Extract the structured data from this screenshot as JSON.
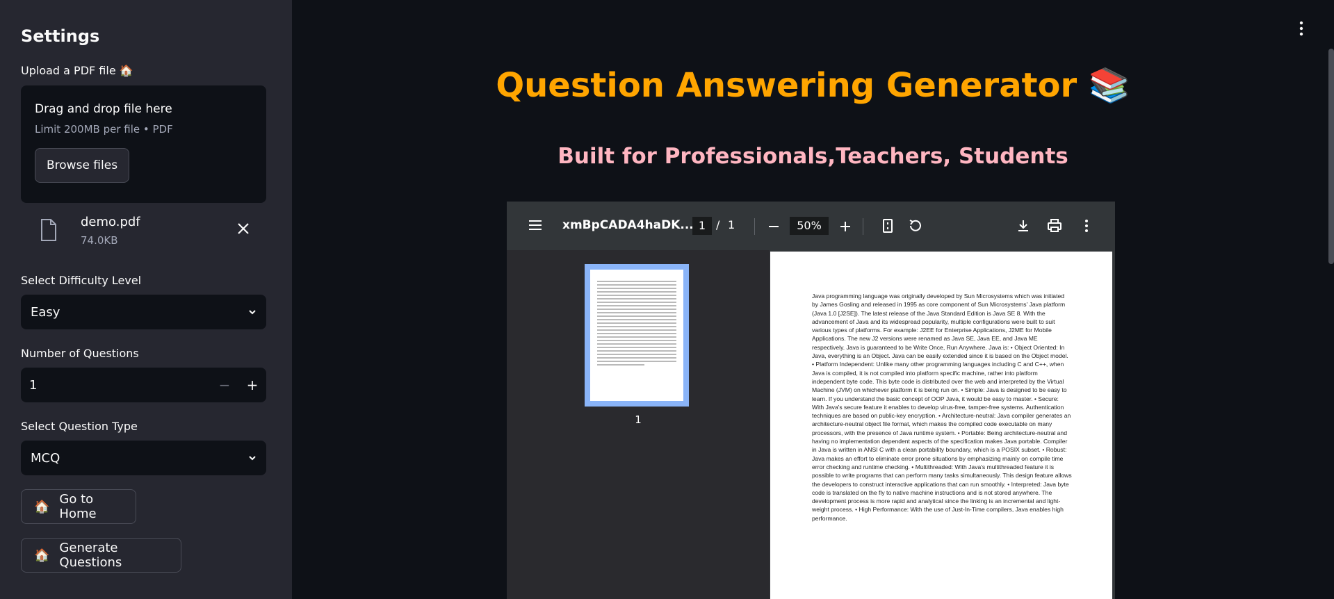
{
  "sidebar": {
    "title": "Settings",
    "upload_label": "Upload a PDF file 🏠",
    "dropzone": {
      "title": "Drag and drop file here",
      "subtitle": "Limit 200MB per file • PDF",
      "browse_label": "Browse files"
    },
    "file": {
      "name": "demo.pdf",
      "size": "74.0KB"
    },
    "difficulty": {
      "label": "Select Difficulty Level",
      "value": "Easy"
    },
    "num_questions": {
      "label": "Number of Questions",
      "value": "1",
      "minus": "−",
      "plus": "+"
    },
    "question_type": {
      "label": "Select Question Type",
      "value": "MCQ"
    },
    "home_button": {
      "icon": "🏠",
      "label": "Go to Home"
    },
    "generate_button": {
      "icon": "🏠",
      "label": "Generate Questions"
    }
  },
  "main": {
    "title": "Question Answering Generator 📚",
    "subtitle": "Built for Professionals,Teachers, Students"
  },
  "pdf_viewer": {
    "filename": "xmBpCADA4haDK...",
    "page_current": "1",
    "page_separator": "/",
    "page_total": "1",
    "zoom": "50%",
    "thumb_label": "1",
    "page_text": "Java programming language was originally developed by Sun Microsystems which was initiated by James Gosling and released in 1995 as core component of Sun Microsystems' Java platform (Java 1.0 [J2SE]). The latest release of the Java Standard Edition is Java SE 8. With the advancement of Java and its widespread popularity, multiple configurations were built to suit various types of platforms. For example: J2EE for Enterprise Applications, J2ME for Mobile Applications. The new J2 versions were renamed as Java SE, Java EE, and Java ME respectively. Java is guaranteed to be Write Once, Run Anywhere. Java is: • Object Oriented: In Java, everything is an Object. Java can be easily extended since it is based on the Object model. • Platform Independent: Unlike many other programming languages including C and C++, when Java is compiled, it is not compiled into platform specific machine, rather into platform independent byte code. This byte code is distributed over the web and interpreted by the Virtual Machine (JVM) on whichever platform it is being run on. • Simple: Java is designed to be easy to learn. If you understand the basic concept of OOP Java, it would be easy to master. • Secure: With Java's secure feature it enables to develop virus-free, tamper-free systems. Authentication techniques are based on public-key encryption. • Architecture-neutral: Java compiler generates an architecture-neutral object file format, which makes the compiled code executable on many processors, with the presence of Java runtime system. • Portable: Being architecture-neutral and having no implementation dependent aspects of the specification makes Java portable. Compiler in Java is written in ANSI C with a clean portability boundary, which is a POSIX subset. • Robust: Java makes an effort to eliminate error prone situations by emphasizing mainly on compile time error checking and runtime checking. • Multithreaded: With Java's multithreaded feature it is possible to write programs that can perform many tasks simultaneously. This design feature allows the developers to construct interactive applications that can run smoothly. • Interpreted: Java byte code is translated on the fly to native machine instructions and is not stored anywhere. The development process is more rapid and analytical since the linking is an incremental and light-weight process. • High Performance: With the use of Just-In-Time compilers, Java enables high performance."
  },
  "colors": {
    "title": "#ffa500",
    "subtitle": "#ffb6c1",
    "sidebar_bg": "#262730",
    "main_bg": "#0e1117"
  }
}
